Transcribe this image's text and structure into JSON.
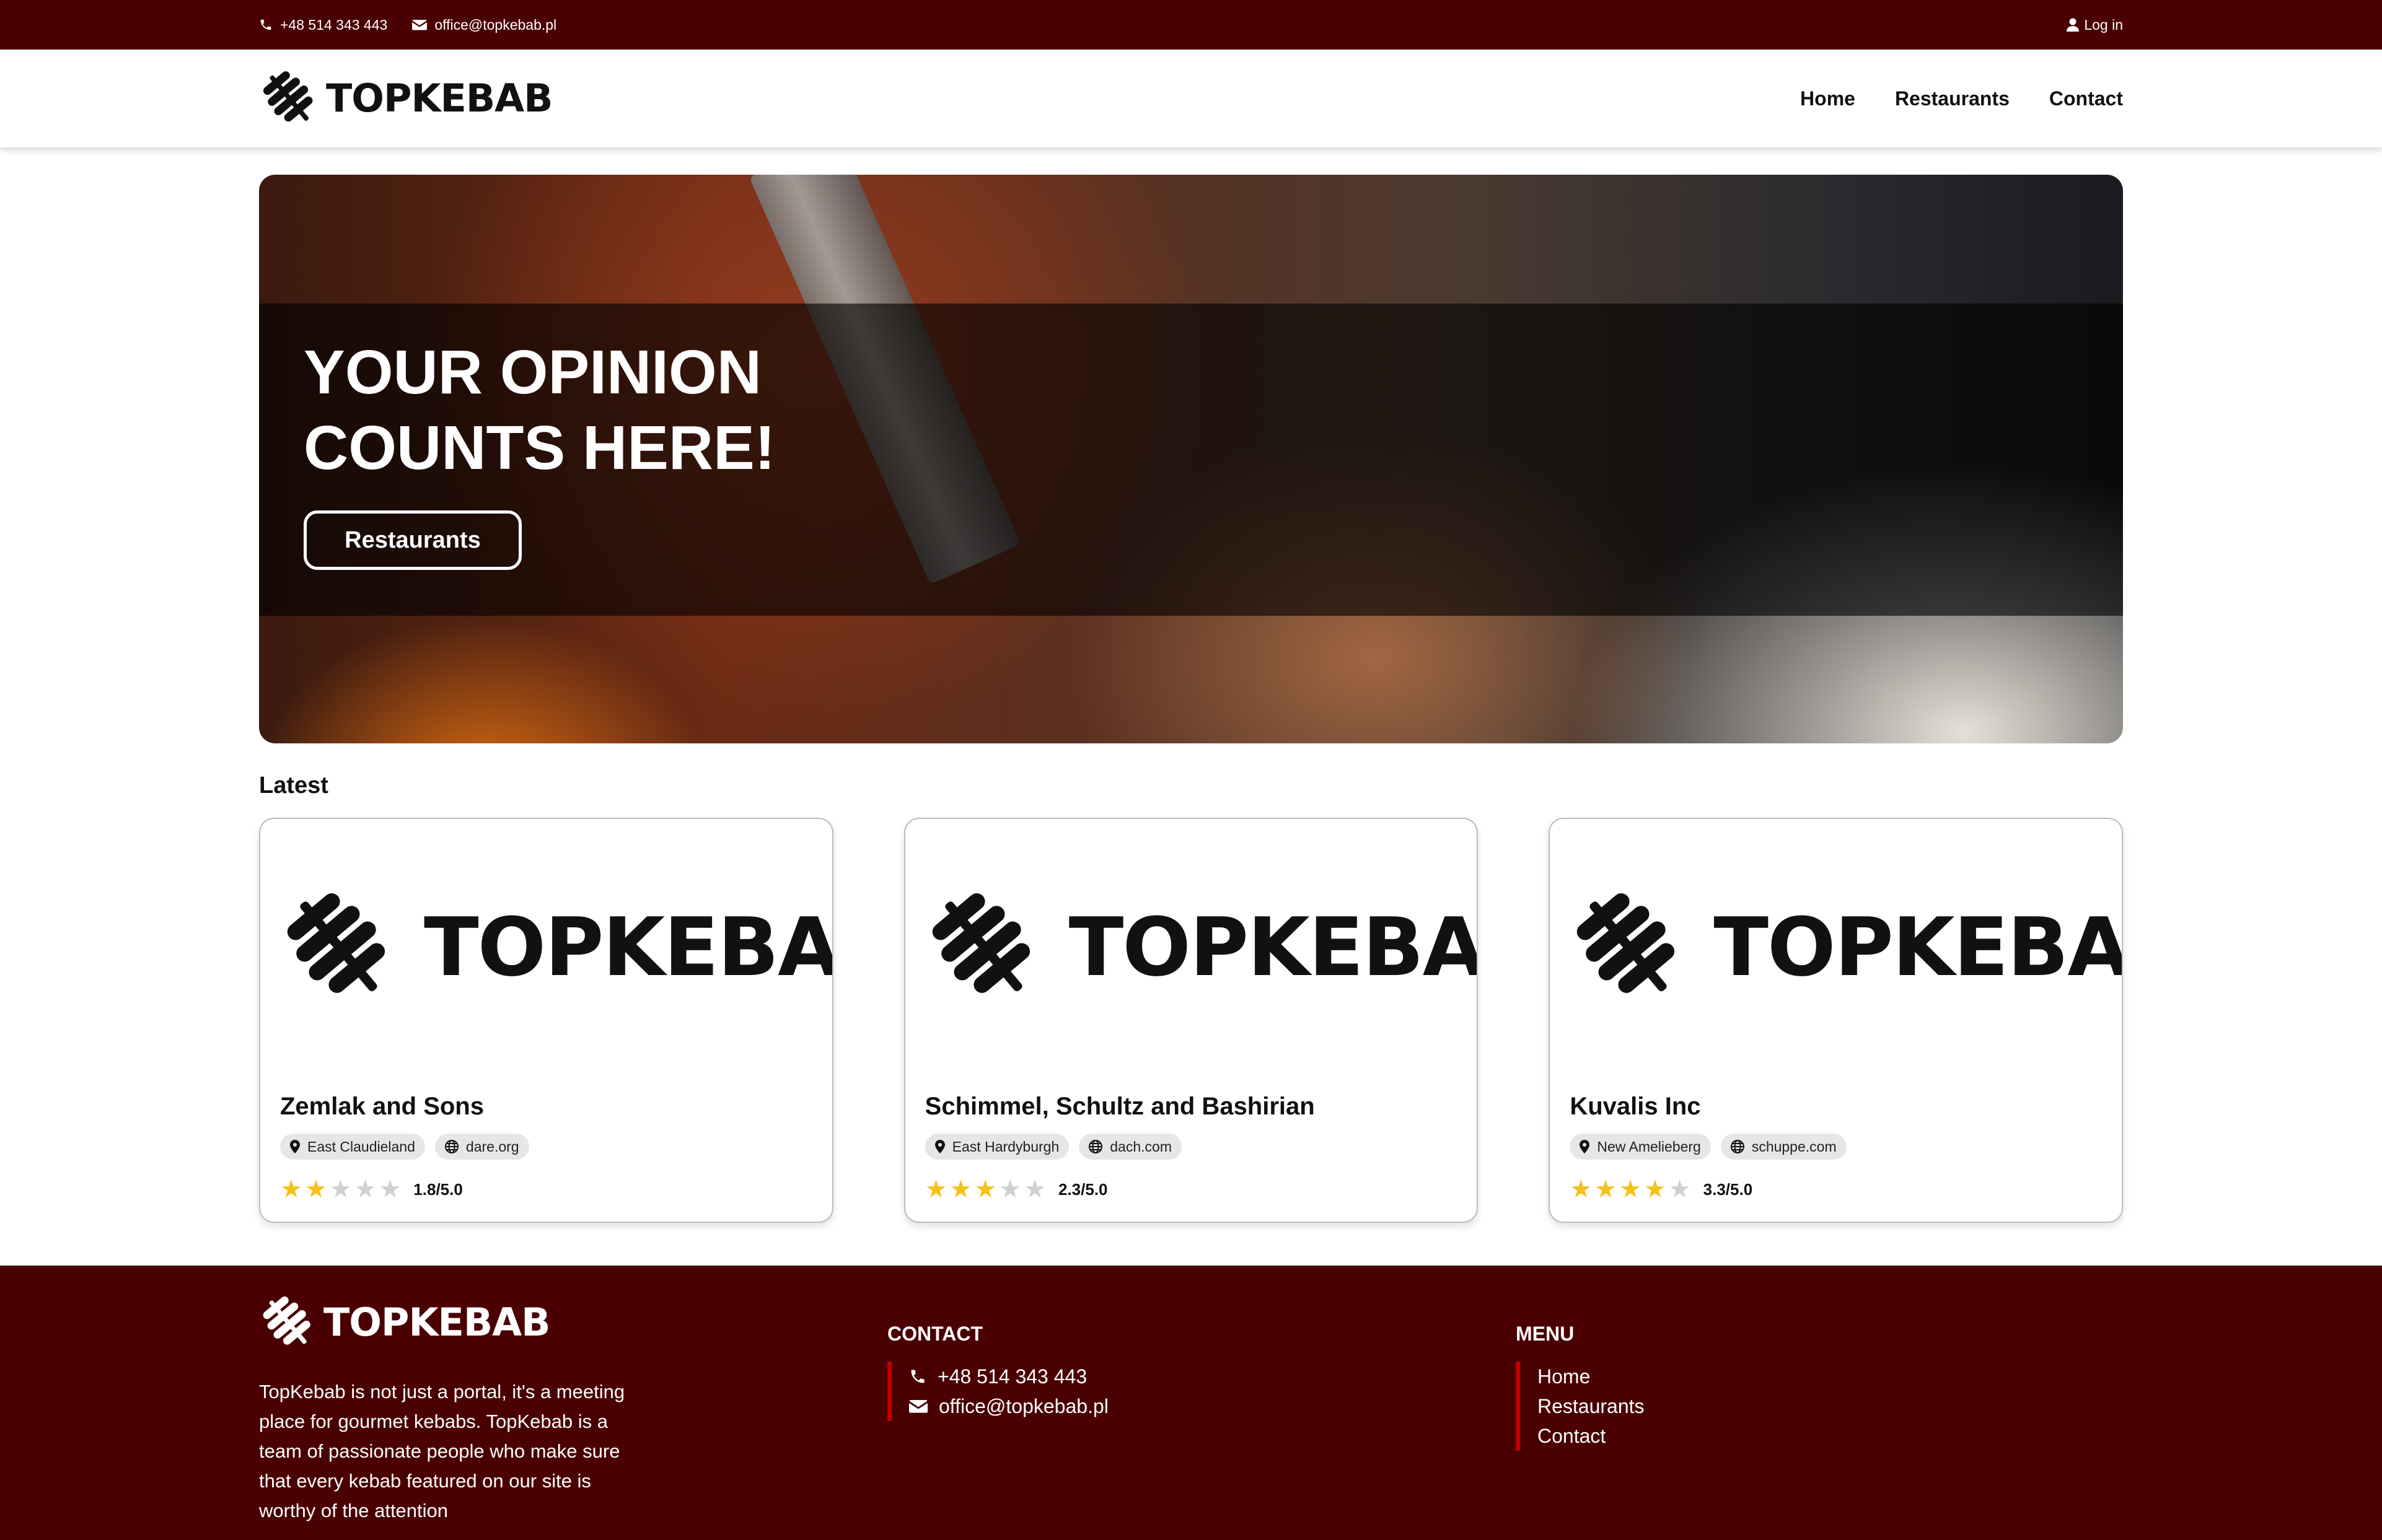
{
  "topbar": {
    "phone": "+48 514 343 443",
    "email": "office@topkebab.pl",
    "login_label": "Log in"
  },
  "brand": {
    "name": "TOPKEBAB"
  },
  "nav": {
    "home": "Home",
    "restaurants": "Restaurants",
    "contact": "Contact"
  },
  "hero": {
    "title_line1": "YOUR OPINION",
    "title_line2": "COUNTS HERE!",
    "button_label": "Restaurants"
  },
  "latest": {
    "title": "Latest",
    "cards": [
      {
        "name": "Zemlak and Sons",
        "location": "East Claudieland",
        "website": "dare.org",
        "rating": 1.8,
        "rating_label": "1.8/5.0",
        "stars_filled": 2
      },
      {
        "name": "Schimmel, Schultz and Bashirian",
        "location": "East Hardyburgh",
        "website": "dach.com",
        "rating": 2.3,
        "rating_label": "2.3/5.0",
        "stars_filled": 3
      },
      {
        "name": "Kuvalis Inc",
        "location": "New Amelieberg",
        "website": "schuppe.com",
        "rating": 3.3,
        "rating_label": "3.3/5.0",
        "stars_filled": 4
      }
    ]
  },
  "footer": {
    "description": "TopKebab is not just a portal, it's a meeting place for gourmet kebabs. TopKebab is a team of passionate people who make sure that every kebab featured on our site is worthy of the attention",
    "contact_heading": "CONTACT",
    "phone": "+48 514 343 443",
    "email": "office@topkebab.pl",
    "menu_heading": "MENU",
    "menu": {
      "home": "Home",
      "restaurants": "Restaurants",
      "contact": "Contact"
    }
  },
  "colors": {
    "brand_dark": "#4a0000",
    "accent_red": "#c00000",
    "star": "#f4c21a"
  },
  "icons": [
    "phone-icon",
    "envelope-icon",
    "user-icon",
    "kebab-logo-icon",
    "location-pin-icon",
    "globe-icon",
    "star-icon"
  ]
}
